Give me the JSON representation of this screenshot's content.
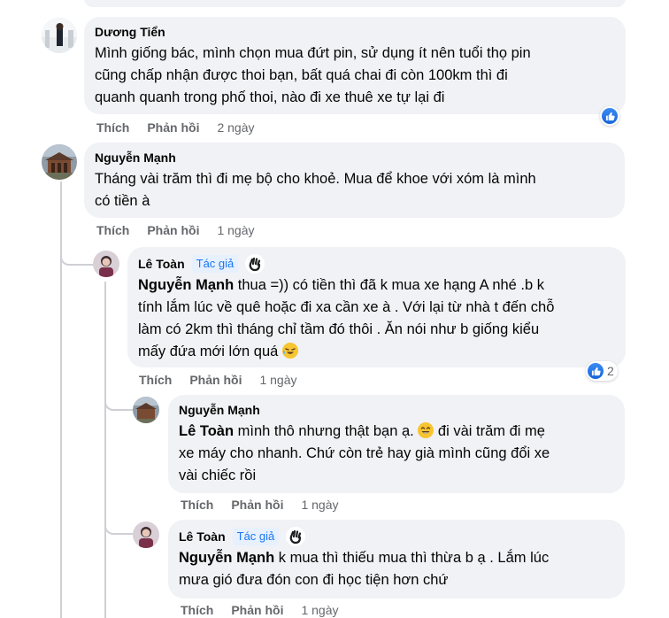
{
  "comments": [
    {
      "author": "Dương Tiển",
      "lines": [
        "Mình giống bác, mình chọn mua đứt pin, sử dụng ít nên tuổi thọ pin",
        "cũng chấp nhận được thoi bạn, bất quá chai đi còn 100km thì đi",
        "quanh quanh trong phố thoi, nào đi xe thuê xe tự lại đi"
      ],
      "like": "Thích",
      "reply": "Phản hồi",
      "time": "2 ngày"
    },
    {
      "author": "Nguyễn Mạnh",
      "lines": [
        "Tháng vài trăm thì đi mẹ bộ cho khoẻ. Mua để khoe với xóm là mình",
        "có tiền à"
      ],
      "like": "Thích",
      "reply": "Phản hồi",
      "time": "1 ngày"
    },
    {
      "author": "Lê Toàn",
      "badge": "Tác giả",
      "mention": "Nguyễn Mạnh",
      "first_line_rest": " thua =)) có tiền thì đã k mua xe hạng A nhé .b k",
      "lines": [
        "tính lắm lúc về quê hoặc đi xa cần xe à . Với lại từ nhà t đến chỗ",
        "làm có 2km thì tháng chỉ tầm đó thôi . Ăn nói như b giống kiểu",
        "mấy đứa mới lớn quá"
      ],
      "reaction_count": "2",
      "like": "Thích",
      "reply": "Phản hồi",
      "time": "1 ngày"
    },
    {
      "author": "Nguyễn Mạnh",
      "mention": "Lê Toàn",
      "first_line_rest": " mình thô nhưng thật bạn ạ.",
      "first_line_tail": " đi vài trăm đi mẹ",
      "lines": [
        "xe máy cho nhanh. Chứ còn trẻ hay già mình cũng đổi xe",
        "vài chiếc rồi"
      ],
      "like": "Thích",
      "reply": "Phản hồi",
      "time": "1 ngày"
    },
    {
      "author": "Lê Toàn",
      "badge": "Tác giả",
      "mention": "Nguyễn Mạnh",
      "first_line_rest": " k mua thì thiếu mua thì thừa b ạ . Lắm lúc",
      "lines": [
        "mưa gió đưa đón con đi học tiện hơn chứ"
      ],
      "like": "Thích",
      "reply": "Phản hồi",
      "time": "1 ngày"
    }
  ],
  "colors": {
    "bubble": "#f0f2f5",
    "meta": "#65676b",
    "accent": "#1877f2",
    "thread_line": "#ced0d4"
  },
  "icons": [
    "like-reaction-icon",
    "wave-hand-icon",
    "laughing-emoji-icon",
    "grinning-emoji-icon"
  ]
}
